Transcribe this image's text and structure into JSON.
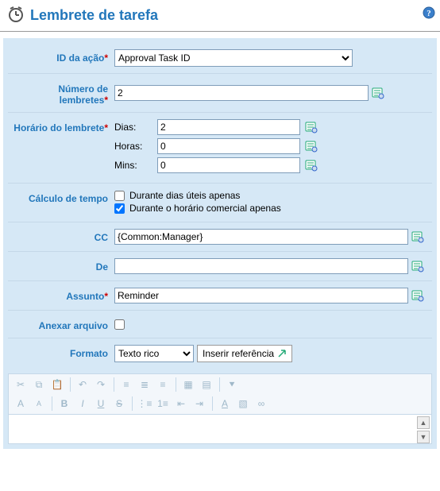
{
  "header": {
    "title": "Lembrete de tarefa"
  },
  "action": {
    "label": "ID da ação",
    "selected": "Approval Task ID",
    "options": [
      "Approval Task ID"
    ]
  },
  "reminders": {
    "label": "Número de lembretes",
    "value": "2"
  },
  "time": {
    "label": "Horário do lembrete",
    "days_label": "Dias:",
    "days_value": "2",
    "hours_label": "Horas:",
    "hours_value": "0",
    "mins_label": "Mins:",
    "mins_value": "0"
  },
  "calc": {
    "label": "Cálculo de tempo",
    "opt1_label": "Durante dias úteis apenas",
    "opt1_checked": false,
    "opt2_label": "Durante o horário comercial apenas",
    "opt2_checked": true
  },
  "cc": {
    "label": "CC",
    "value": "{Common:Manager}"
  },
  "from": {
    "label": "De",
    "value": ""
  },
  "subject": {
    "label": "Assunto",
    "value": "Reminder"
  },
  "attach": {
    "label": "Anexar arquivo",
    "checked": false
  },
  "format": {
    "label": "Formato",
    "selected": "Texto rico",
    "options": [
      "Texto rico"
    ],
    "insert_ref": "Inserir referência"
  }
}
